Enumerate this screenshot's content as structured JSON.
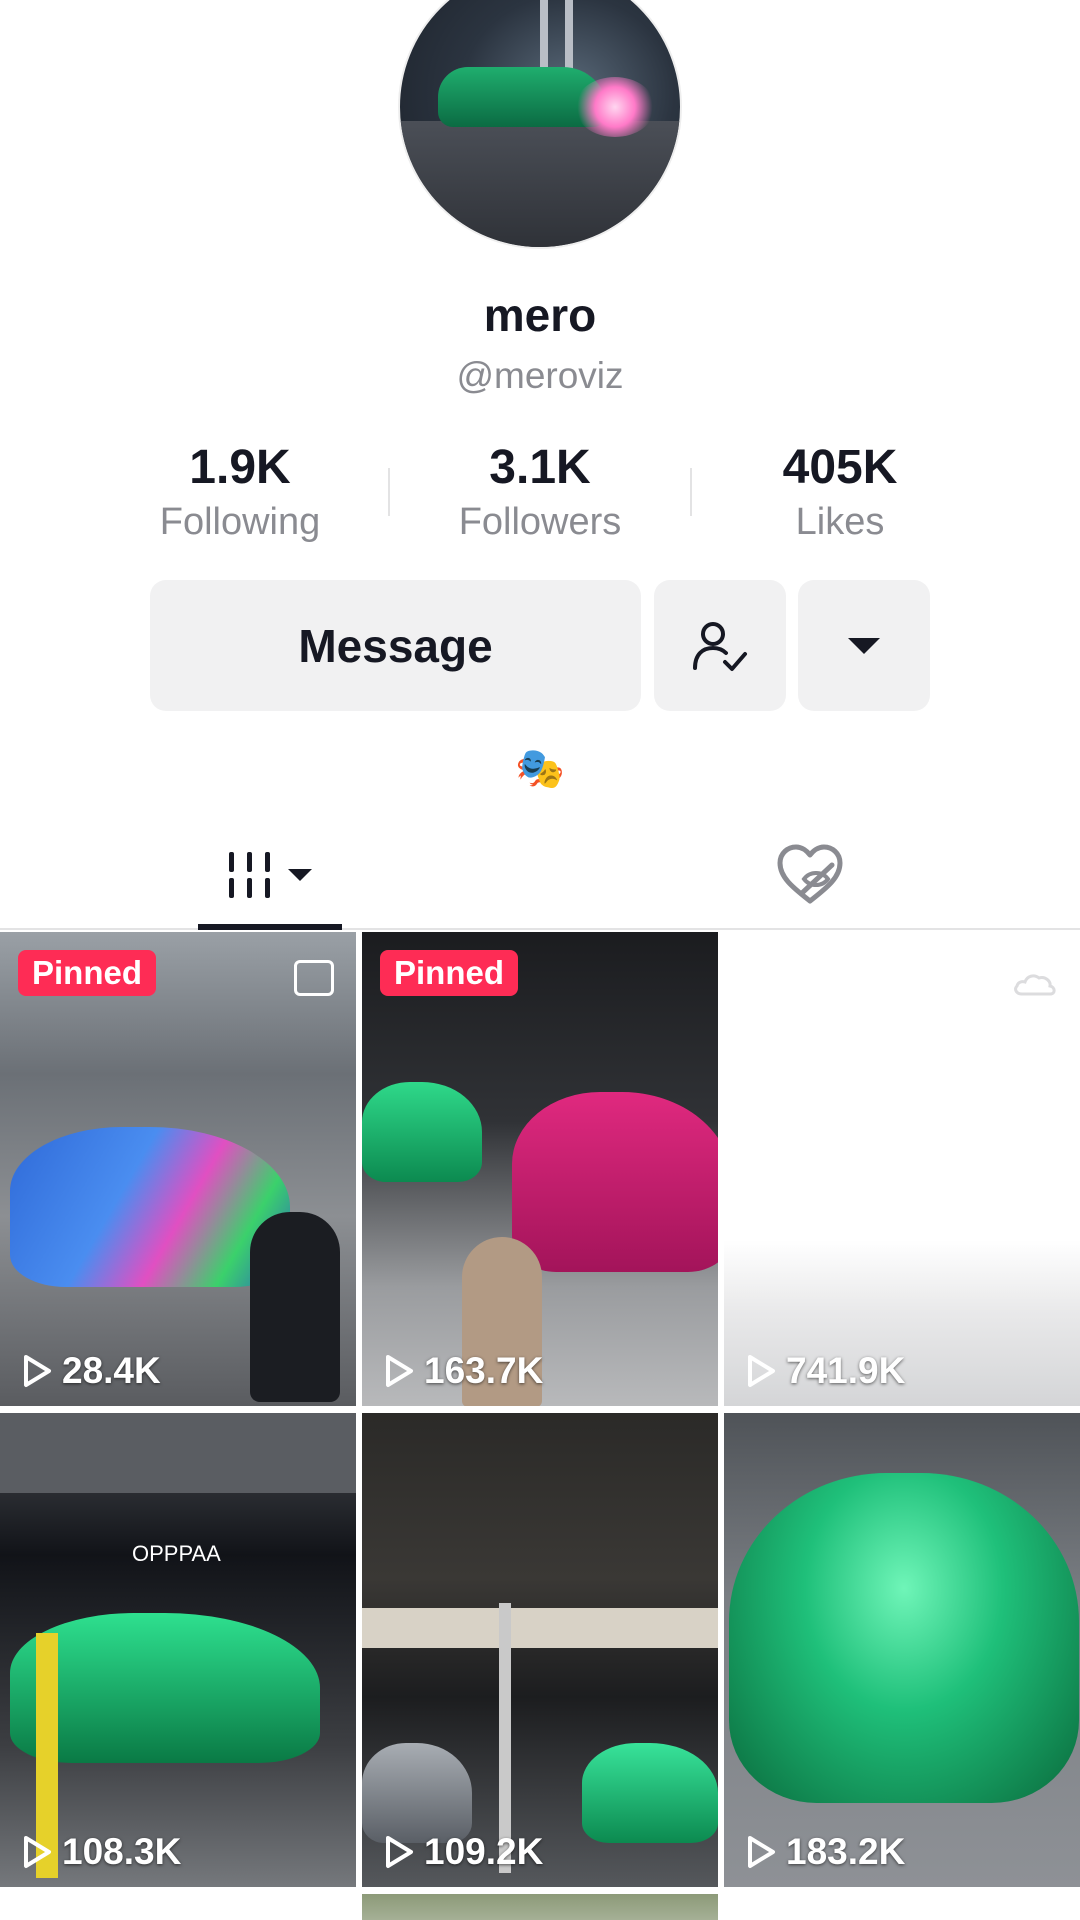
{
  "profile": {
    "display_name": "mero",
    "username": "@meroviz"
  },
  "stats": [
    {
      "value": "1.9K",
      "label": "Following"
    },
    {
      "value": "3.1K",
      "label": "Followers"
    },
    {
      "value": "405K",
      "label": "Likes"
    }
  ],
  "actions": {
    "message_label": "Message",
    "follow_icon": "person-check-icon",
    "more_icon": "caret-down-icon"
  },
  "bio": {
    "emoji": "🎭"
  },
  "tabs": {
    "videos_icon": "grid-icon",
    "liked_icon": "hidden-heart-icon"
  },
  "videos": [
    {
      "views": "28.4K",
      "pinned": "Pinned",
      "type_icon": "photo-icon"
    },
    {
      "views": "163.7K",
      "pinned": "Pinned"
    },
    {
      "views": "741.9K",
      "status_icon": "cloud-icon"
    },
    {
      "views": "108.3K",
      "overlay_text": "OPPPAA"
    },
    {
      "views": "109.2K"
    },
    {
      "views": "183.2K"
    }
  ],
  "colors": {
    "pinned_badge": "#fe2c55",
    "button_bg": "#f1f1f2",
    "muted_text": "#8a8b91"
  }
}
